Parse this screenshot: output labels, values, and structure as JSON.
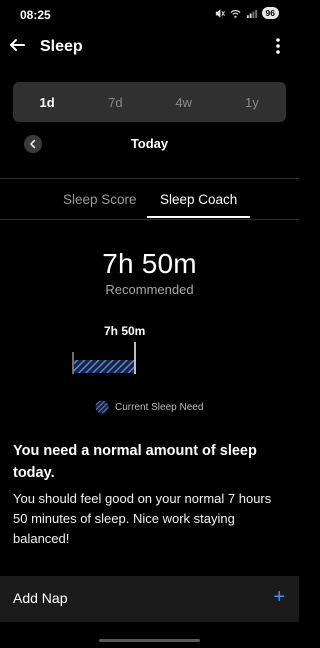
{
  "status_bar": {
    "time": "08:25",
    "battery": "96"
  },
  "header": {
    "title": "Sleep"
  },
  "range_tabs": [
    {
      "label": "1d",
      "active": true
    },
    {
      "label": "7d",
      "active": false
    },
    {
      "label": "4w",
      "active": false
    },
    {
      "label": "1y",
      "active": false
    }
  ],
  "date_nav": {
    "label": "Today"
  },
  "sub_tabs": {
    "score": "Sleep Score",
    "coach": "Sleep Coach",
    "active": "Sleep Coach"
  },
  "coach": {
    "duration": "7h 50m",
    "duration_caption": "Recommended",
    "need_marker_label": "7h 50m",
    "legend_label": "Current Sleep Need",
    "heading": "You need a normal amount of sleep today.",
    "body": "You should feel good on your normal 7 hours 50 minutes of sleep. Nice work staying balanced!"
  },
  "nap": {
    "label": "Add Nap",
    "action_symbol": "+"
  },
  "colors": {
    "accent_blue": "#3f8cff",
    "hatch_blue": "#4a74c9"
  }
}
